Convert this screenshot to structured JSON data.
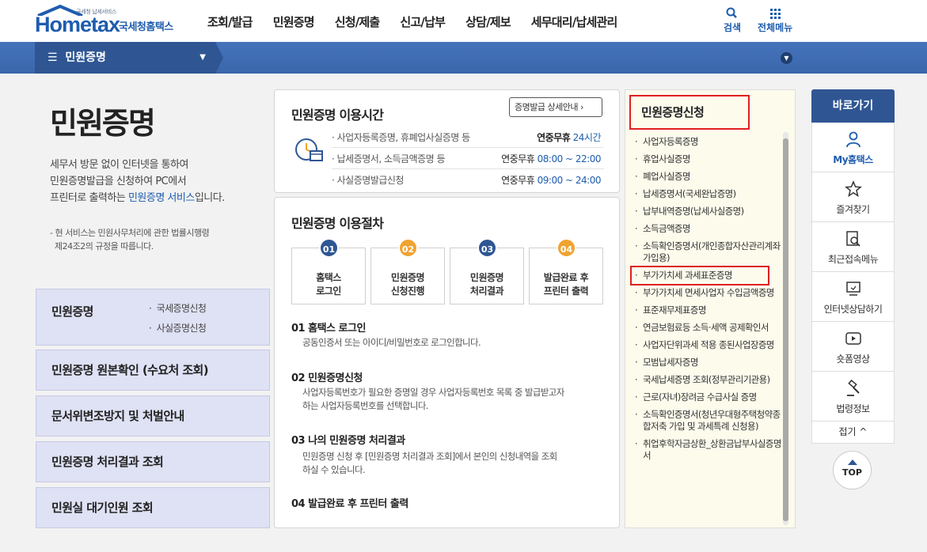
{
  "header": {
    "logo_tagline": "국세청 납세서비스",
    "logo_brand": "Hometax",
    "logo_sub": "국세청홈택스",
    "nav": [
      "조회/발급",
      "민원증명",
      "신청/제출",
      "신고/납부",
      "상담/제보",
      "세무대리/납세관리"
    ],
    "search_label": "검색",
    "allmenu_label": "전체메뉴"
  },
  "subbar": {
    "current": "민원증명"
  },
  "left": {
    "title": "민원증명",
    "intro": [
      "세무서 방문 없이 인터넷을 통하여",
      "민원증명발급을 신청하여 PC에서",
      "프린터로 출력하는 ",
      "민원증명 서비스",
      "입니다."
    ],
    "note": [
      "- 현 서비스는 민원사무처리에 관한 법률시행령",
      "제24조2의 규정을 따릅니다."
    ],
    "box1_title": "민원증명",
    "box1_links": [
      "국세증명신청",
      "사실증명신청"
    ],
    "boxes": [
      "민원증명 원본확인 (수요처 조회)",
      "문서위변조방지 및 처벌안내",
      "민원증명 처리결과 조회",
      "민원실 대기인원 조회"
    ]
  },
  "usage_time": {
    "title": "민원증명 이용시간",
    "detail_button": "증명발급 상세안내",
    "rows": [
      {
        "label": "사업자등록증명, 휴폐업사실증명 등",
        "prefix": "연중무휴",
        "value": "24시간"
      },
      {
        "label": "납세증명서, 소득금액증명 등",
        "prefix": "연중무휴",
        "value": "08:00 ~ 22:00"
      },
      {
        "label": "사실증명발급신청",
        "prefix": "연중무휴",
        "value": "09:00 ~ 24:00"
      }
    ]
  },
  "procedure": {
    "title": "민원증명 이용절차",
    "steps": [
      {
        "num": "01",
        "line1": "홈택스",
        "line2": "로그인",
        "color": "#2f5693"
      },
      {
        "num": "02",
        "line1": "민원증명",
        "line2": "신청진행",
        "color": "#f0a330"
      },
      {
        "num": "03",
        "line1": "민원증명",
        "line2": "처리결과",
        "color": "#2f5693"
      },
      {
        "num": "04",
        "line1": "발급완료 후",
        "line2": "프린터 출력",
        "color": "#f0a330"
      }
    ],
    "sections": [
      {
        "head": "01 홈택스 로그인",
        "desc": [
          "공동인증서 또는 아이디/비밀번호로 로그인합니다."
        ]
      },
      {
        "head": "02 민원증명신청",
        "desc": [
          "사업자등록번호가 필요한 증명일 경우 사업자등록번호 목록 중 발급받고자",
          "하는 사업자등록번호를 선택합니다."
        ]
      },
      {
        "head": "03 나의 민원증명 처리결과",
        "desc": [
          "민원증명 신청 후 [민원증명 처리결과 조회]에서 본인의 신청내역을 조회",
          "하실 수 있습니다."
        ]
      },
      {
        "head": "04 발급완료 후 프린터 출력",
        "desc": []
      }
    ]
  },
  "apply_list": {
    "title": "민원증명신청",
    "items": [
      "사업자등록증명",
      "휴업사실증명",
      "폐업사실증명",
      "납세증명서(국세완납증명)",
      "납부내역증명(납세사실증명)",
      "소득금액증명",
      "소득확인증명서(개인종합자산관리계좌 가입용)",
      "부가가치세 과세표준증명",
      "부가가치세 면세사업자 수입금액증명",
      "표준재무제표증명",
      "연금보험료등 소득·세액 공제확인서",
      "사업자단위과세 적용 종된사업장증명",
      "모범납세자증명",
      "국세납세증명 조회(정부관리기관용)",
      "근로(자녀)장려금 수급사실 증명",
      "소득확인증명서(청년우대형주택청약종합저축 가입 및 과세특례 신청용)",
      "취업후학자금상환_상환금납부사실증명서"
    ]
  },
  "quick": {
    "title": "바로가기",
    "items": [
      "My홈택스",
      "즐겨찾기",
      "최근접속메뉴",
      "인터넷상담하기",
      "숏폼영상",
      "법령정보"
    ],
    "close": "접기",
    "top": "TOP"
  }
}
